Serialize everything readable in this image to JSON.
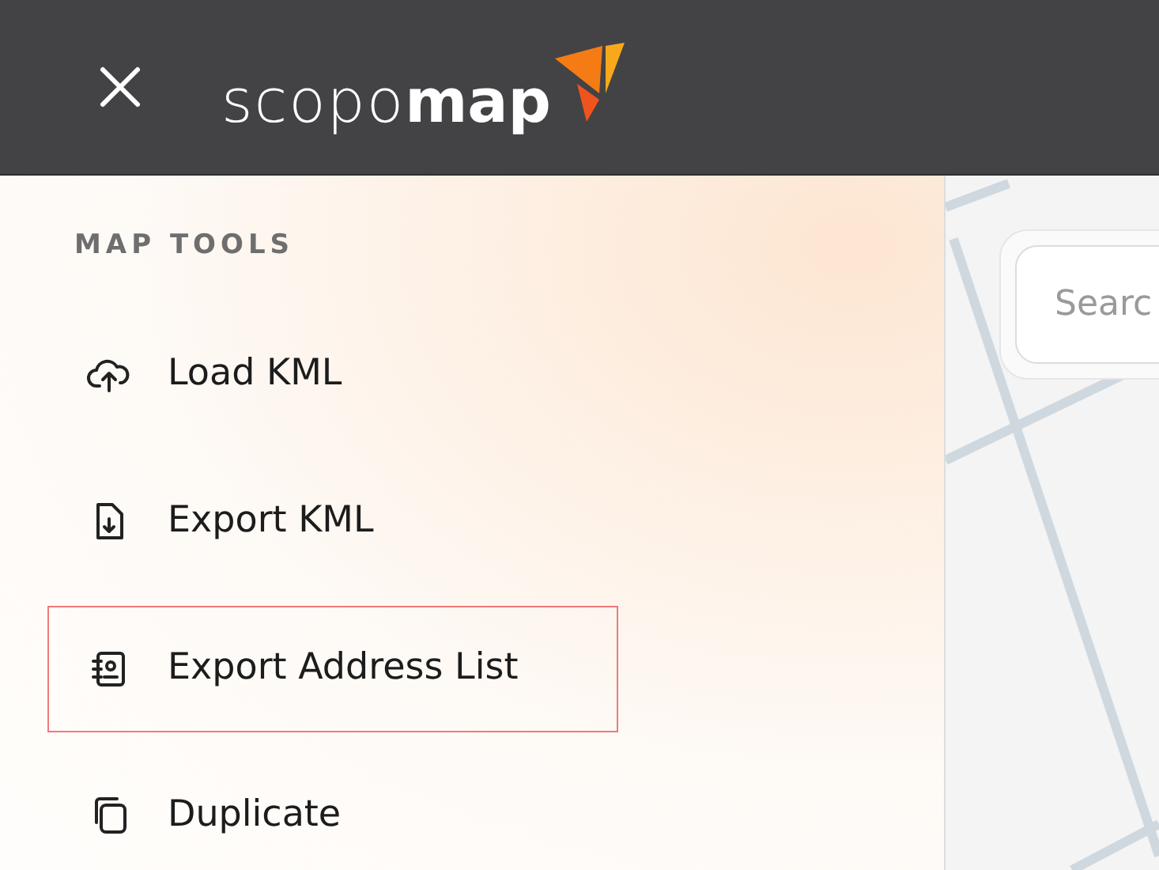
{
  "header": {
    "logo": {
      "light": "scopo",
      "bold": "map"
    }
  },
  "menu": {
    "heading": "MAP TOOLS",
    "items": [
      {
        "label": "Load KML",
        "kind": "upload",
        "selected": false
      },
      {
        "label": "Export KML",
        "kind": "download",
        "selected": false
      },
      {
        "label": "Export Address List",
        "kind": "contacts",
        "selected": true
      },
      {
        "label": "Duplicate",
        "kind": "copy",
        "selected": false
      }
    ]
  },
  "map": {
    "search": {
      "placeholder": "Searc"
    }
  }
}
